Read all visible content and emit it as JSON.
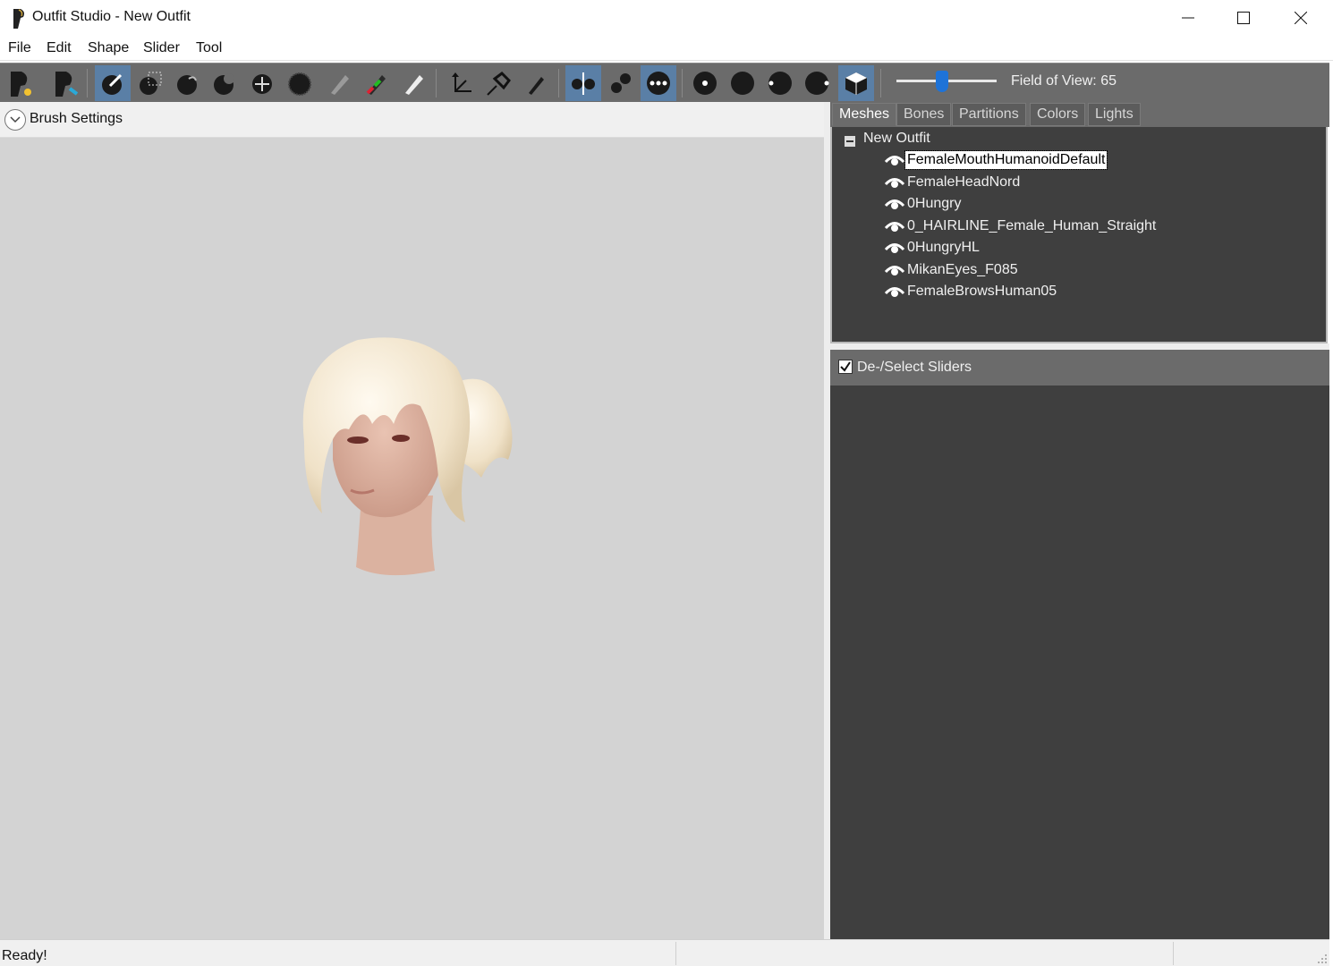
{
  "window": {
    "title": "Outfit Studio - New Outfit",
    "controls": [
      "minimize",
      "maximize",
      "close"
    ]
  },
  "menu": [
    "File",
    "Edit",
    "Shape",
    "Slider",
    "Tool"
  ],
  "toolbar": {
    "tools": [
      {
        "icon": "new-project-icon",
        "active": false
      },
      {
        "icon": "load-project-icon",
        "active": false
      },
      {
        "icon": "select-brush-icon",
        "active": true
      },
      {
        "icon": "mask-brush-icon",
        "active": false
      },
      {
        "icon": "inflate-brush-icon",
        "active": false
      },
      {
        "icon": "deflate-brush-icon",
        "active": false
      },
      {
        "icon": "move-brush-icon",
        "active": false
      },
      {
        "icon": "smooth-brush-icon",
        "active": false
      },
      {
        "icon": "undiff-brush-icon",
        "active": false
      },
      {
        "icon": "color-brush-icon",
        "active": false
      },
      {
        "icon": "alpha-brush-icon",
        "active": false
      },
      {
        "icon": "transform-icon",
        "active": false
      },
      {
        "icon": "pivot-icon",
        "active": false
      },
      {
        "icon": "edit-weight-icon",
        "active": false
      },
      {
        "icon": "x-mirror-icon",
        "active": true
      },
      {
        "icon": "connected-only-icon",
        "active": false
      },
      {
        "icon": "global-brush-icon",
        "active": true
      },
      {
        "icon": "vertex-display-icon",
        "active": false
      },
      {
        "icon": "wireframe-icon",
        "active": false
      },
      {
        "icon": "lighting-icon",
        "active": false
      },
      {
        "icon": "texture-icon",
        "active": false
      },
      {
        "icon": "view-cube-icon",
        "active": true
      }
    ],
    "field_of_view": {
      "label": "Field of View: 65",
      "value": 65
    }
  },
  "brush_settings": {
    "label": "Brush Settings"
  },
  "tabs": [
    "Meshes",
    "Bones",
    "Partitions",
    "Colors",
    "Lights"
  ],
  "active_tab": "Meshes",
  "mesh_tree": {
    "root": "New Outfit",
    "items": [
      {
        "label": "FemaleMouthHumanoidDefault",
        "selected": true
      },
      {
        "label": "FemaleHeadNord",
        "selected": false
      },
      {
        "label": "0Hungry",
        "selected": false
      },
      {
        "label": "0_HAIRLINE_Female_Human_Straight",
        "selected": false
      },
      {
        "label": "0HungryHL",
        "selected": false
      },
      {
        "label": "MikanEyes_F085",
        "selected": false
      },
      {
        "label": "FemaleBrowsHuman05",
        "selected": false
      }
    ]
  },
  "sliders": {
    "header": "De-/Select Sliders",
    "checked": true
  },
  "status": {
    "text": "Ready!"
  },
  "colors": {
    "toolbar": "#6b6b6b",
    "panel": "#3f3f3f",
    "viewport": "#d3d3d3",
    "accent": "#1e73d8",
    "active_tool": "#5a7fa6"
  }
}
